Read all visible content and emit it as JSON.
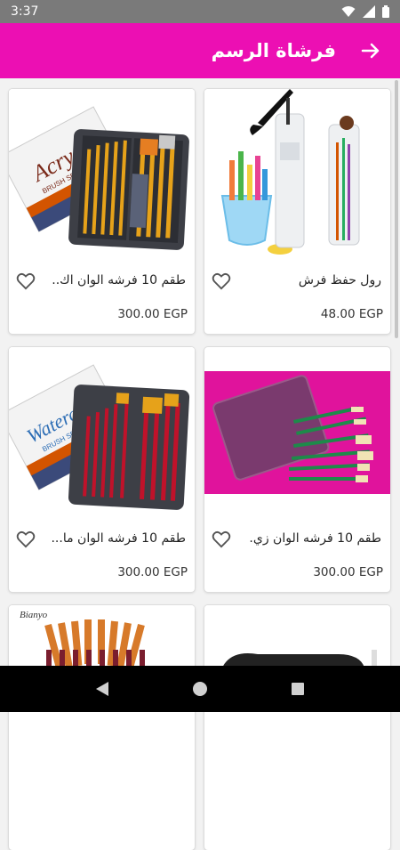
{
  "status_bar": {
    "time": "3:37"
  },
  "app_bar": {
    "title": "فرشاة الرسم"
  },
  "products": [
    {
      "name": "رول حفظ فرش",
      "price": "48.00 EGP"
    },
    {
      "name": "طقم 10 فرشه الوان اك...",
      "price": "300.00 EGP"
    },
    {
      "name": "طقم 10 فرشه الوان زي...",
      "price": "300.00 EGP"
    },
    {
      "name": "طقم 10 فرشه الوان ما...",
      "price": "300.00 EGP"
    }
  ],
  "product_images": [
    {
      "brand_text": "Acry",
      "label": "BRUSH SET"
    },
    {
      "brand_text": "Waterc",
      "label": "BRUSH SET"
    },
    {
      "brand_text": "Bianyo"
    }
  ]
}
